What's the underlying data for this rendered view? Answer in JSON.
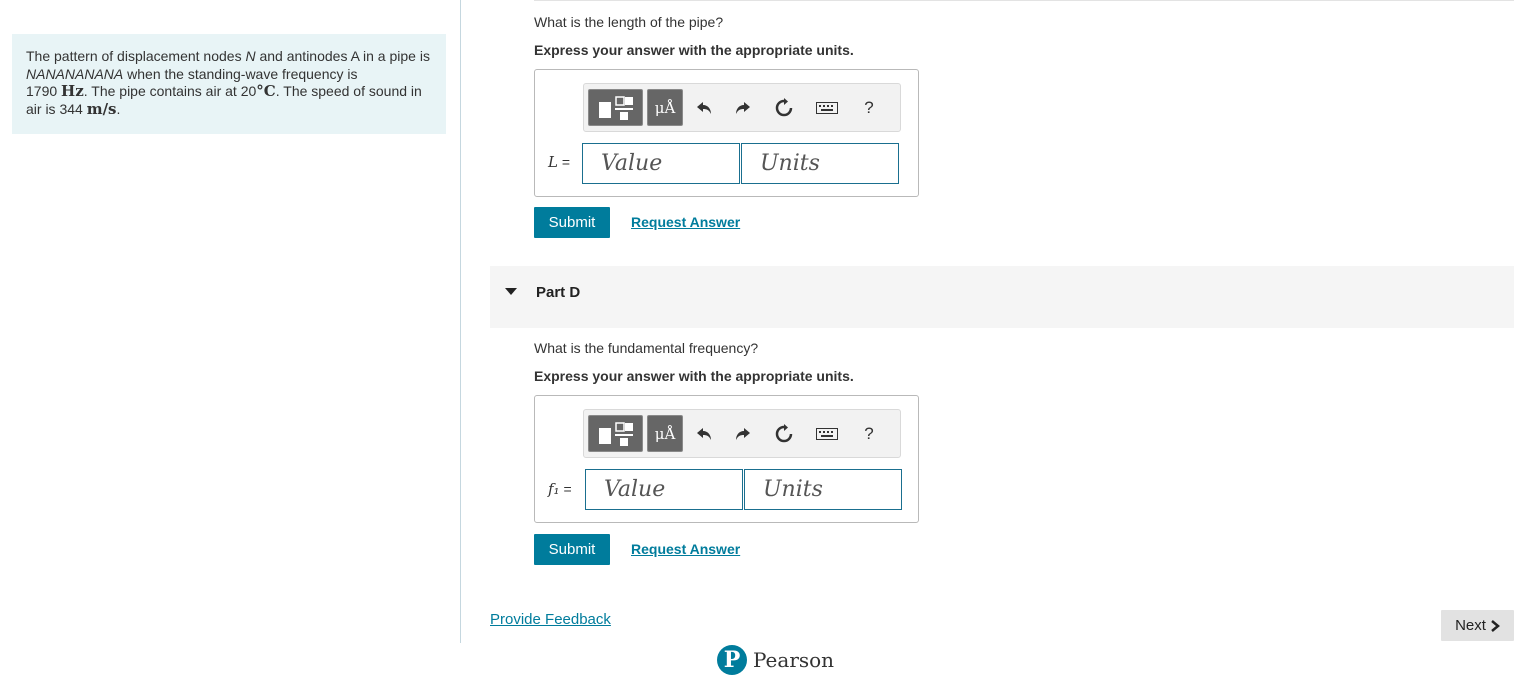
{
  "problem": {
    "text_1": "The pattern of displacement nodes ",
    "node_letter": "N",
    "text_2": " and antinodes A in a pipe is ",
    "pattern": "NANANANANA",
    "text_3": " when the standing-wave frequency is",
    "freq_value": "1790",
    "freq_unit": "Hz",
    "text_4": ". The pipe contains air at ",
    "temp_value": "20",
    "temp_unit": "°C",
    "text_5": ". The speed of sound in air is ",
    "speed_value": "344",
    "speed_unit": "m/s",
    "text_6": "."
  },
  "part_c": {
    "question": "What is the length of the pipe?",
    "instruction": "Express your answer with the appropriate units.",
    "var_label": "L",
    "eq": "=",
    "value_placeholder": "Value",
    "units_placeholder": "Units",
    "submit_label": "Submit",
    "request_label": "Request Answer"
  },
  "part_d": {
    "header": "Part D",
    "question": "What is the fundamental frequency?",
    "instruction": "Express your answer with the appropriate units.",
    "var_label": "f₁",
    "eq": "=",
    "value_placeholder": "Value",
    "units_placeholder": "Units",
    "submit_label": "Submit",
    "request_label": "Request Answer"
  },
  "toolbar": {
    "units_symbol": "μÅ",
    "help_symbol": "?",
    "icons": [
      "templates-icon",
      "units-icon",
      "undo-icon",
      "redo-icon",
      "reset-icon",
      "keyboard-icon",
      "help-icon"
    ]
  },
  "footer": {
    "feedback_label": "Provide Feedback",
    "next_label": "Next",
    "brand_letter": "P",
    "brand_name": "Pearson"
  },
  "colors": {
    "accent": "#007c9c",
    "problem_bg": "#e8f4f6",
    "part_header_bg": "#f5f5f5",
    "next_bg": "#e2e2e2"
  }
}
